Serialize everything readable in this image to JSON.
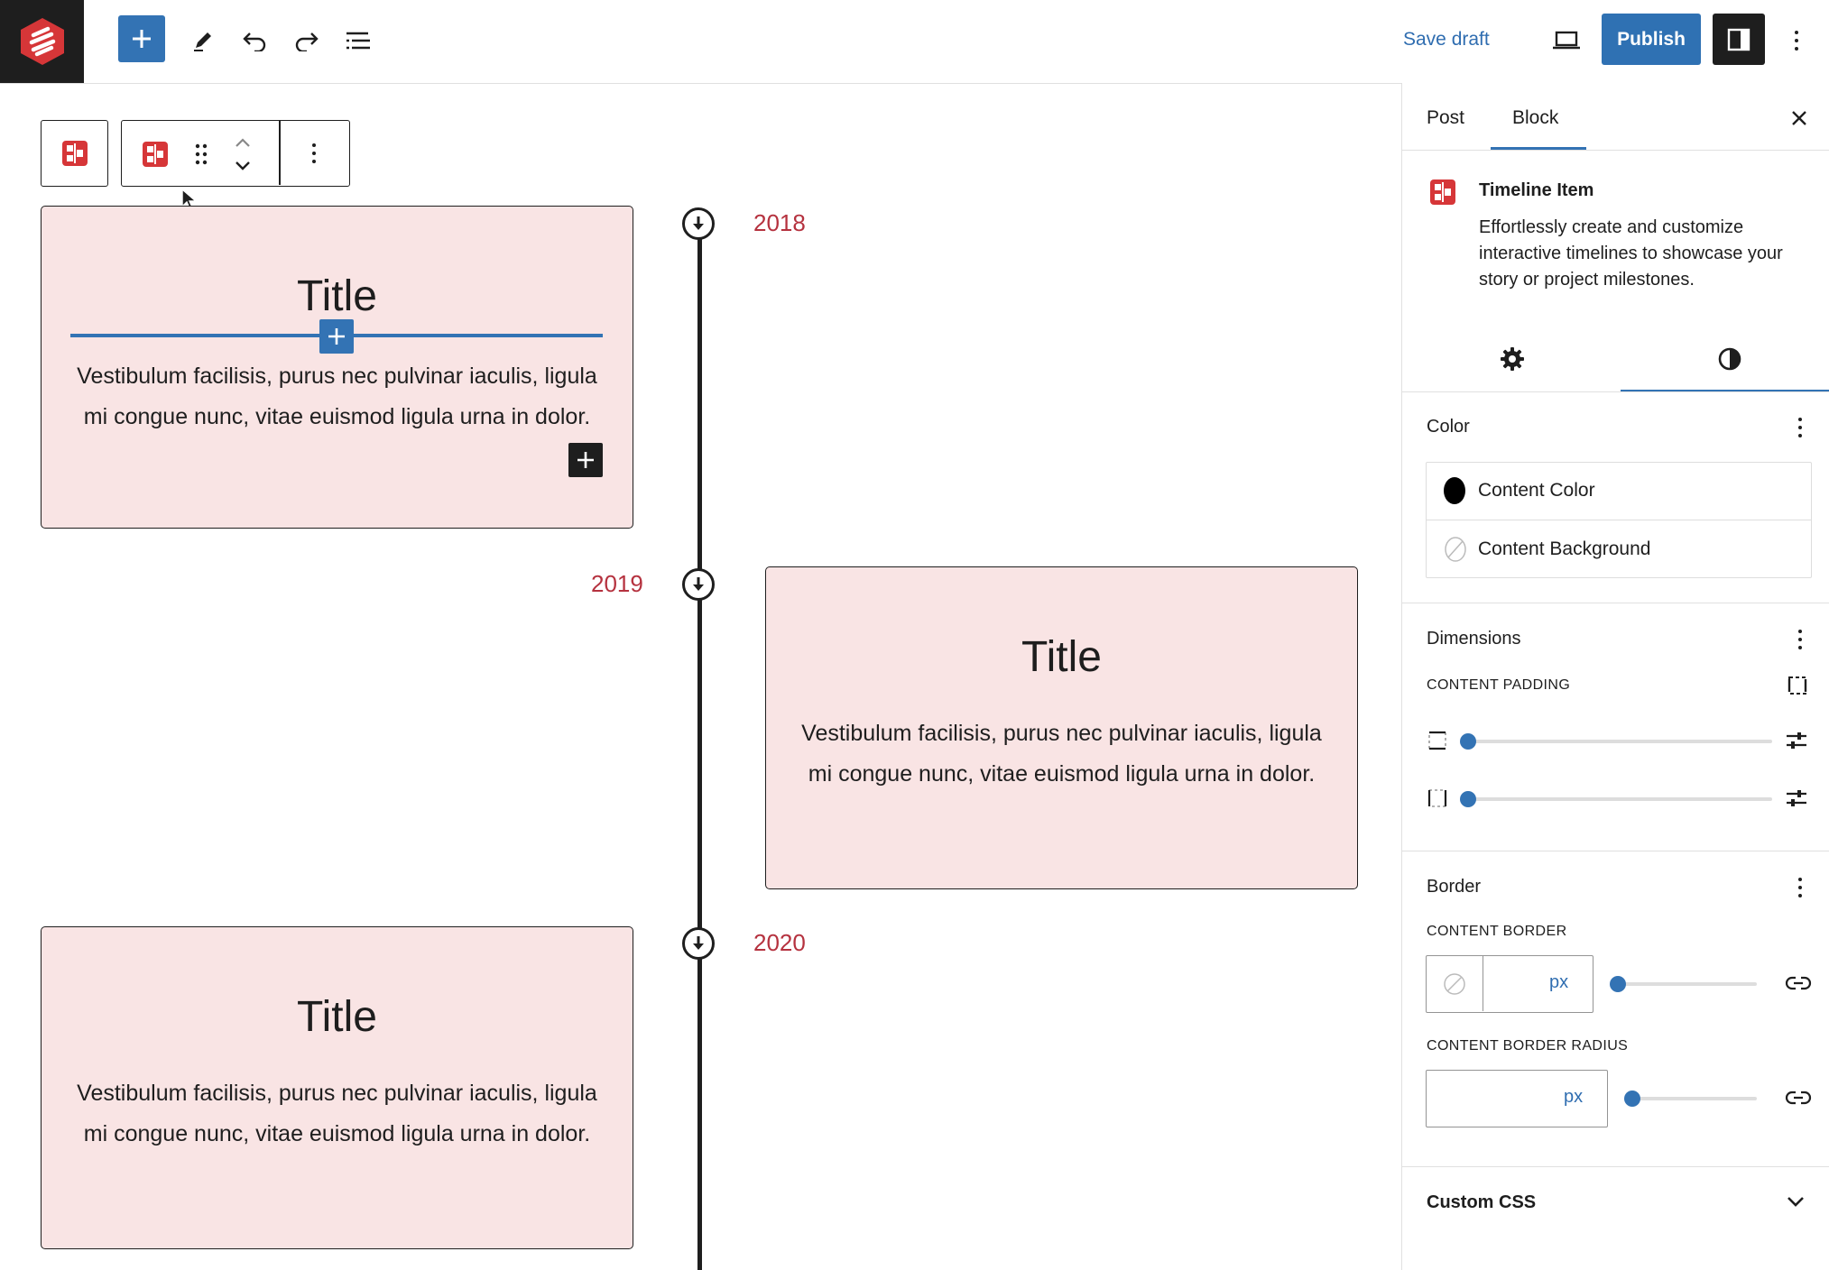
{
  "topbar": {
    "save_draft": "Save draft",
    "publish": "Publish"
  },
  "timeline": {
    "items": [
      {
        "year": "2018",
        "title": "Title",
        "text": "Vestibulum facilisis, purus nec pulvinar iaculis, ligula mi congue nunc, vitae euismod ligula urna in dolor."
      },
      {
        "year": "2019",
        "title": "Title",
        "text": "Vestibulum facilisis, purus nec pulvinar iaculis, ligula mi congue nunc, vitae euismod ligula urna in dolor."
      },
      {
        "year": "2020",
        "title": "Title",
        "text": "Vestibulum facilisis, purus nec pulvinar iaculis, ligula mi congue nunc, vitae euismod ligula urna in dolor."
      }
    ]
  },
  "sidebar": {
    "tabs": [
      "Post",
      "Block"
    ],
    "active_tab": "Block",
    "block_name": "Timeline Item",
    "block_description": "Effortlessly create and customize interactive timelines to showcase your story or project milestones.",
    "color": {
      "title": "Color",
      "content_color": "Content Color",
      "content_background": "Content Background"
    },
    "dimensions": {
      "title": "Dimensions",
      "content_padding": "CONTENT PADDING"
    },
    "border": {
      "title": "Border",
      "content_border": "CONTENT BORDER",
      "content_border_unit": "px",
      "content_border_radius": "CONTENT BORDER RADIUS",
      "content_border_radius_unit": "px"
    },
    "custom_css": "Custom CSS"
  },
  "colors": {
    "accent": "#3373b4",
    "card_bg": "#f9e4e4",
    "year": "#b5323f",
    "logo_red": "#d63638"
  }
}
